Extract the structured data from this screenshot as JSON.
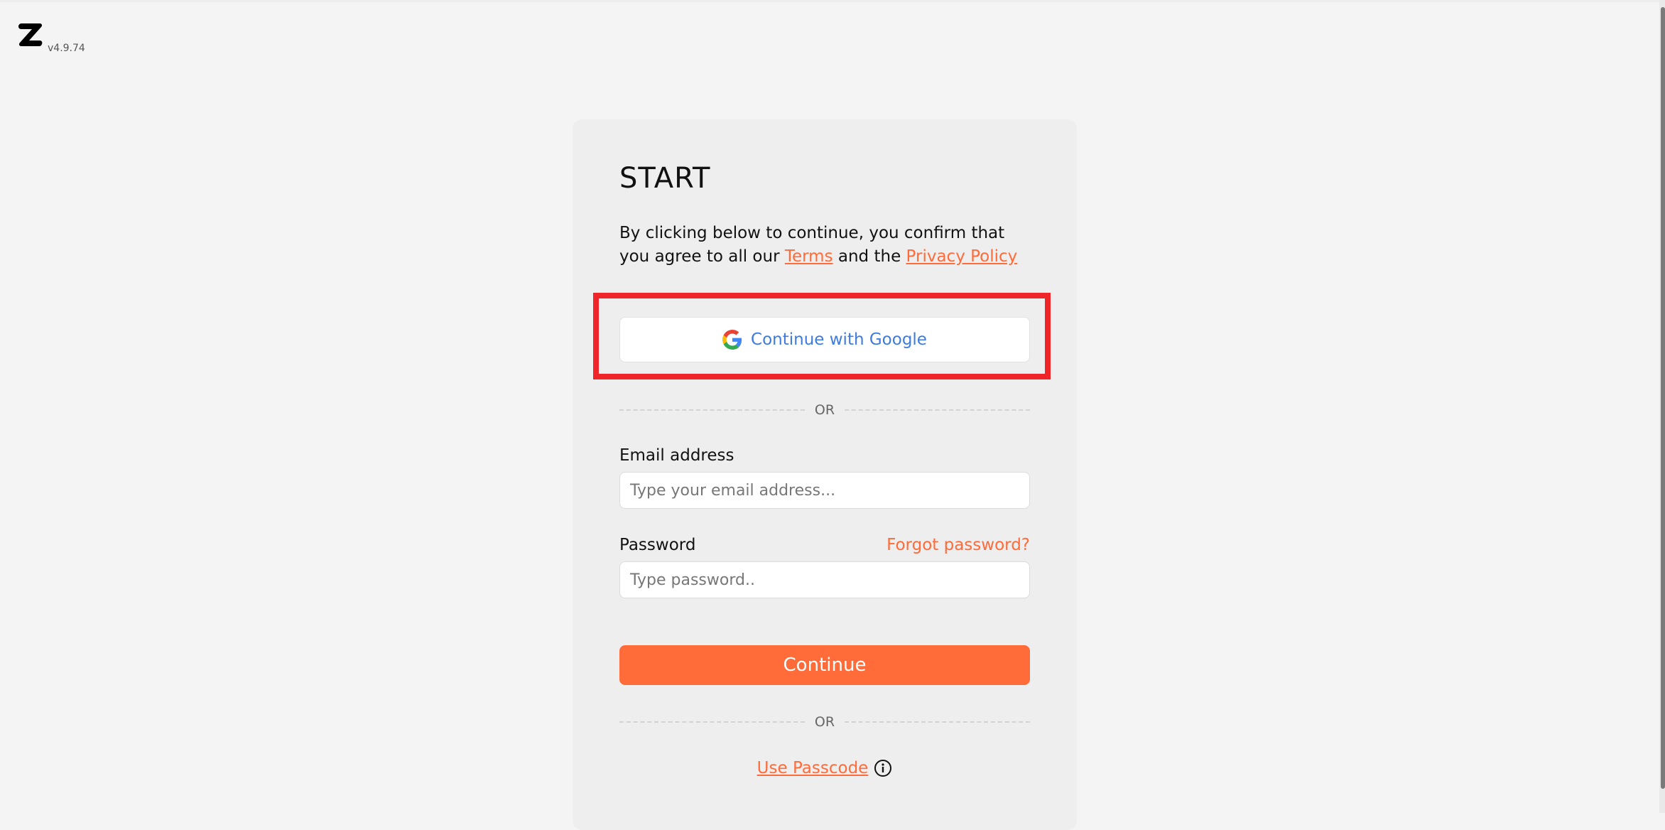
{
  "app": {
    "version": "v4.9.74",
    "logo_icon": "z-logo-icon"
  },
  "colors": {
    "accent": "#ff6b39",
    "google_text": "#3d7be0",
    "highlight": "#f0252a",
    "background": "#f4f4f4",
    "card": "#eeeeee"
  },
  "card": {
    "title": "START",
    "consent_prefix": "By clicking below to continue, you confirm that you agree to all our",
    "terms_label": "Terms",
    "consent_mid": "and the",
    "privacy_label": "Privacy Policy",
    "google_button_label": "Continue with Google",
    "google_icon": "google-g-icon",
    "divider_1": "OR",
    "email": {
      "label": "Email address",
      "placeholder": "Type your email address...",
      "value": ""
    },
    "password": {
      "label": "Password",
      "placeholder": "Type password..",
      "value": "",
      "forgot_label": "Forgot password?"
    },
    "continue_label": "Continue",
    "divider_2": "OR",
    "passcode_label": "Use Passcode",
    "passcode_info_icon": "info-icon"
  }
}
